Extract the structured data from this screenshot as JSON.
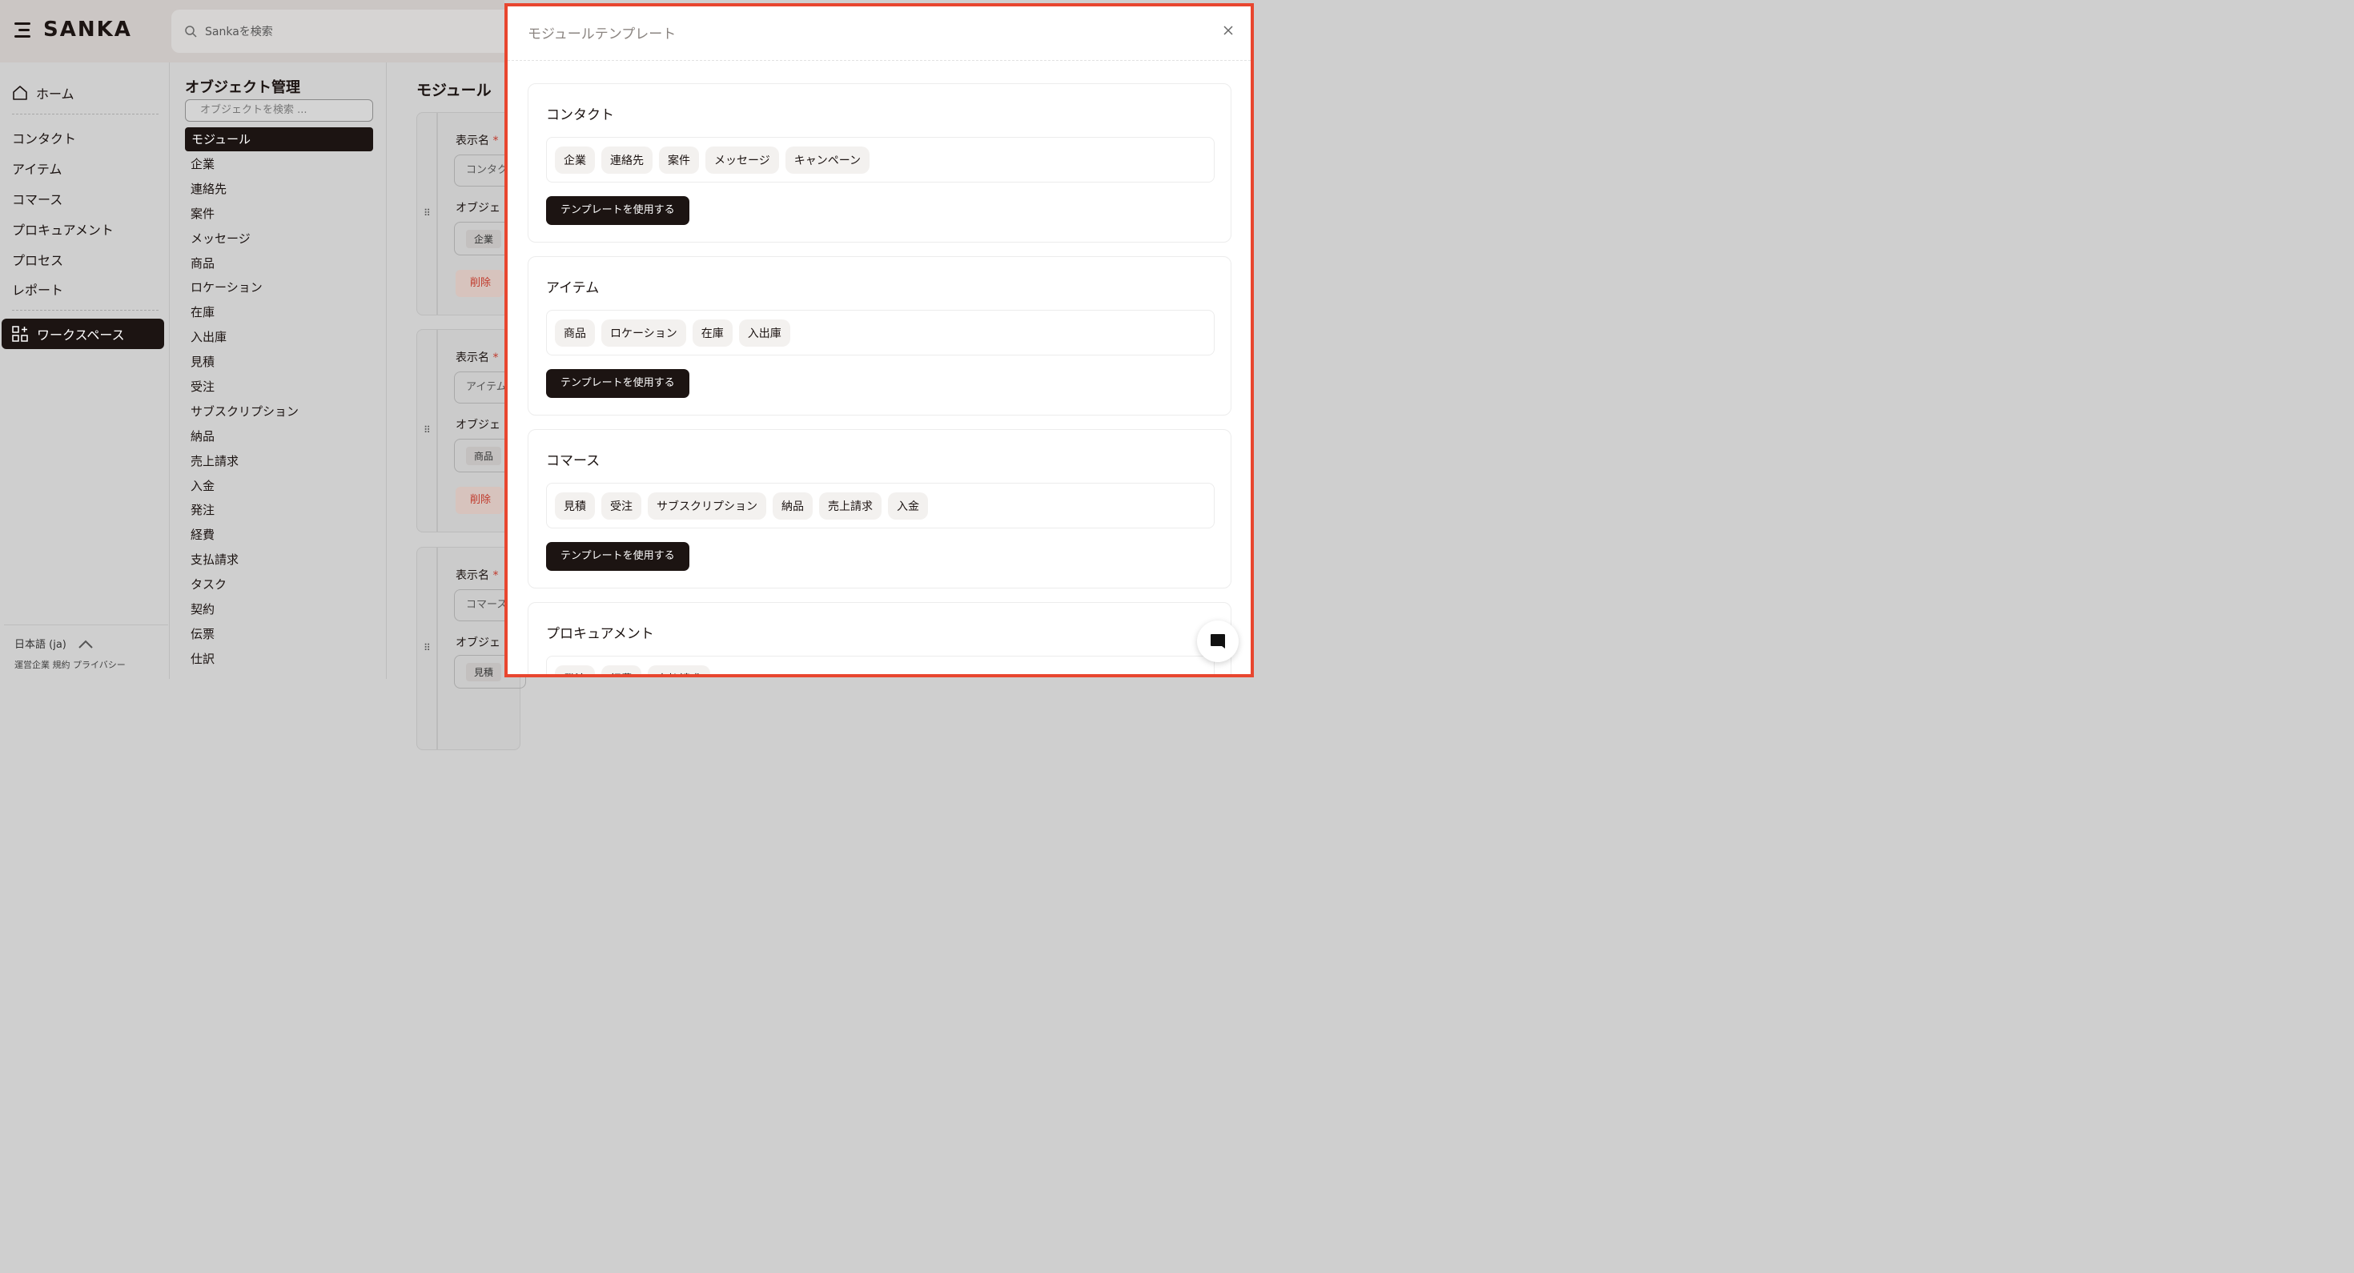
{
  "brand": {
    "name": "SANKA"
  },
  "search": {
    "placeholder": "Sankaを検索"
  },
  "nav": {
    "home": "ホーム",
    "items": [
      "コンタクト",
      "アイテム",
      "コマース",
      "プロキュアメント",
      "プロセス",
      "レポート"
    ],
    "workspace": "ワークスペース",
    "language": "日本語 (ja)",
    "footer": "運営企業 規約 プライバシー"
  },
  "objects": {
    "title": "オブジェクト管理",
    "search_placeholder": "オブジェクトを検索 ...",
    "active": "モジュール",
    "items": [
      "企業",
      "連絡先",
      "案件",
      "メッセージ",
      "商品",
      "ロケーション",
      "在庫",
      "入出庫",
      "見積",
      "受注",
      "サブスクリプション",
      "納品",
      "売上請求",
      "入金",
      "発注",
      "経費",
      "支払請求",
      "タスク",
      "契約",
      "伝票",
      "仕訳"
    ]
  },
  "modules": {
    "title": "モジュール",
    "display_name_label": "表示名",
    "required_mark": "*",
    "object_label": "オブジェ",
    "delete_label": "削除",
    "cards": [
      {
        "name": "コンタク",
        "tag": "企業"
      },
      {
        "name": "アイテム",
        "tag": "商品"
      },
      {
        "name": "コマース",
        "tag": "見積"
      }
    ]
  },
  "modal": {
    "title": "モジュールテンプレート",
    "use_label": "テンプレートを使用する",
    "templates": [
      {
        "name": "コンタクト",
        "tags": [
          "企業",
          "連絡先",
          "案件",
          "メッセージ",
          "キャンペーン"
        ]
      },
      {
        "name": "アイテム",
        "tags": [
          "商品",
          "ロケーション",
          "在庫",
          "入出庫"
        ]
      },
      {
        "name": "コマース",
        "tags": [
          "見積",
          "受注",
          "サブスクリプション",
          "納品",
          "売上請求",
          "入金"
        ]
      },
      {
        "name": "プロキュアメント",
        "tags": [
          "発注",
          "経費",
          "支払請求"
        ]
      }
    ]
  },
  "colors": {
    "accent": "#1c1412",
    "highlight_border": "#e8462f",
    "required": "#c0392b"
  }
}
